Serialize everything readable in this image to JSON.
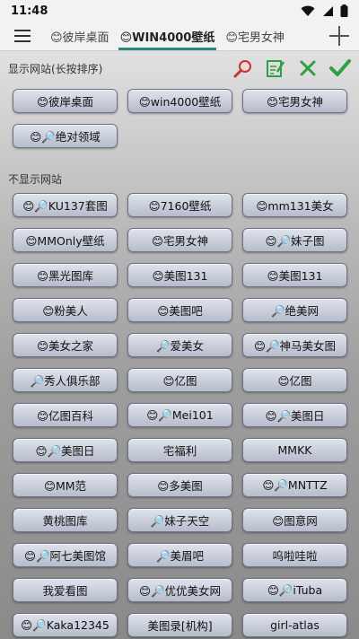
{
  "status": {
    "time": "11:48"
  },
  "tabs": [
    {
      "label": "😊彼岸桌面"
    },
    {
      "label": "😊WIN4000壁纸"
    },
    {
      "label": "😊宅男女神"
    }
  ],
  "shown": {
    "title": "显示网站(长按排序)",
    "items": [
      {
        "label": "😊彼岸桌面"
      },
      {
        "label": "😊win4000壁纸"
      },
      {
        "label": "😊宅男女神"
      },
      {
        "label": "😊🔎绝对领域"
      }
    ]
  },
  "hidden": {
    "title": "不显示网站",
    "items": [
      {
        "label": "😊🔎KU137套图"
      },
      {
        "label": "😊7160壁纸"
      },
      {
        "label": "😊mm131美女"
      },
      {
        "label": "😊MMOnly壁纸"
      },
      {
        "label": "😊宅男女神"
      },
      {
        "label": "😊🔎妹子图"
      },
      {
        "label": "😊黑光图库"
      },
      {
        "label": "😊美图131"
      },
      {
        "label": "😊美图131"
      },
      {
        "label": "😊粉美人"
      },
      {
        "label": "😊美图吧"
      },
      {
        "label": "🔎绝美网"
      },
      {
        "label": "😊美女之家"
      },
      {
        "label": "🔎爱美女"
      },
      {
        "label": "😊🔎神马美女图"
      },
      {
        "label": "🔎秀人俱乐部"
      },
      {
        "label": "😊亿图"
      },
      {
        "label": "😊亿图"
      },
      {
        "label": "😊亿图百科"
      },
      {
        "label": "😊🔎Mei101"
      },
      {
        "label": "😊🔎美图日"
      },
      {
        "label": "😊🔎美图日"
      },
      {
        "label": "宅福利"
      },
      {
        "label": "MMKK"
      },
      {
        "label": "😊MM范"
      },
      {
        "label": "😊多美图"
      },
      {
        "label": "😊🔎MNTTZ"
      },
      {
        "label": "黄桃图库"
      },
      {
        "label": "🔎妹子天空"
      },
      {
        "label": "😊图意网"
      },
      {
        "label": "😊🔎阿七美图馆"
      },
      {
        "label": "🔎美眉吧"
      },
      {
        "label": "呜啦哇啦"
      },
      {
        "label": "我爱看图"
      },
      {
        "label": "😊🔎优优美女网"
      },
      {
        "label": "😊🔎iTuba"
      },
      {
        "label": "😊🔎Kaka12345"
      },
      {
        "label": "美图录[机构]"
      },
      {
        "label": "girl-atlas"
      }
    ]
  },
  "icons": {
    "menu": "hamburger-menu-icon",
    "add": "plus-icon",
    "search": "magnifier-icon",
    "edit": "edit-document-icon",
    "close": "close-x-icon",
    "confirm": "checkmark-icon"
  },
  "colors": {
    "accent": "#2b8a7e",
    "green": "#2ea043",
    "red": "#d03a3a"
  }
}
